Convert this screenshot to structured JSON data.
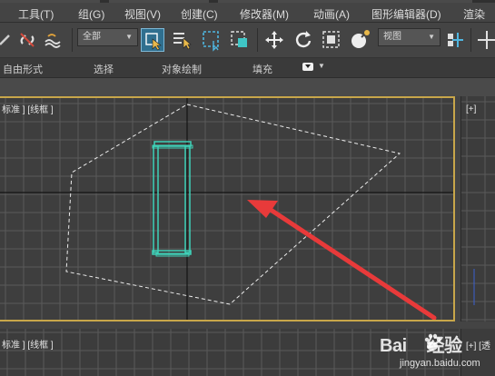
{
  "menu": {
    "items": [
      {
        "label": "工具(T)"
      },
      {
        "label": "组(G)"
      },
      {
        "label": "视图(V)"
      },
      {
        "label": "创建(C)"
      },
      {
        "label": "修改器(M)"
      },
      {
        "label": "动画(A)"
      },
      {
        "label": "图形编辑器(D)"
      },
      {
        "label": "渲染"
      }
    ]
  },
  "toolbar": {
    "selection_filter": "全部",
    "reference_coord": "视图"
  },
  "ribbon": {
    "tabs": [
      {
        "label": "自由形式"
      },
      {
        "label": "选择"
      },
      {
        "label": "对象绘制"
      },
      {
        "label": "填充"
      }
    ]
  },
  "viewports": {
    "main_label": "标准 ] [线框 ]",
    "right_label": "[+]",
    "bottom_label": "标准 ] [线框 ]",
    "bottom_right_label": "[+] [透"
  },
  "watermark": {
    "brand": "Bai",
    "brand_suffix": "经验",
    "url": "jingyan.baidu.com"
  },
  "colors": {
    "viewport_border": "#c8a64a",
    "selected_object": "#3fd1b8",
    "arrow": "#e83a3a",
    "dashed_outline": "#ffffff"
  }
}
